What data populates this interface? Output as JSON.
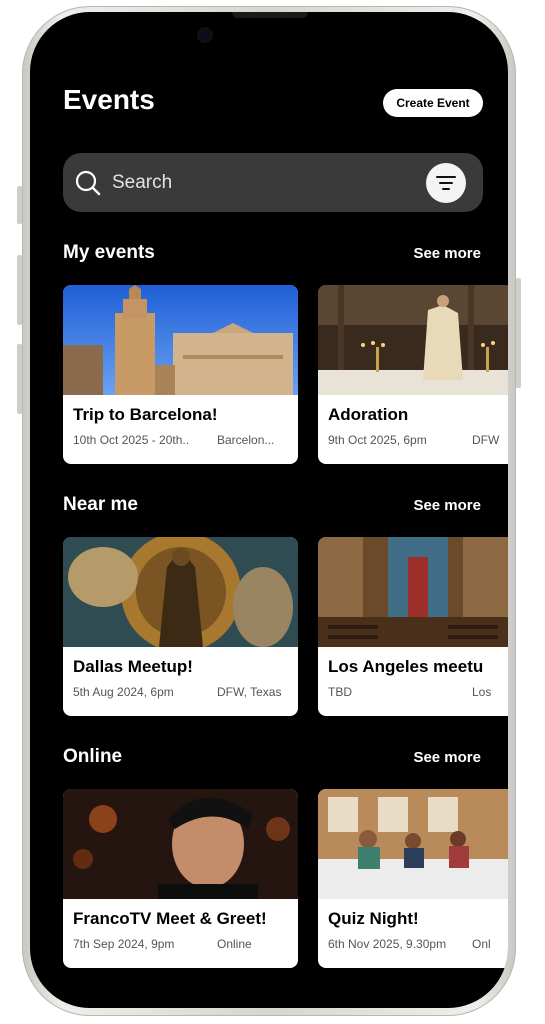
{
  "header": {
    "title": "Events",
    "create_label": "Create Event"
  },
  "search": {
    "placeholder": "Search"
  },
  "sections": [
    {
      "title": "My events",
      "see_more": "See more",
      "cards": [
        {
          "title": "Trip to Barcelona!",
          "date": "10th Oct 2025 - 20th..",
          "location": "Barcelon...",
          "image": "barcelona-cathedral"
        },
        {
          "title": "Adoration",
          "date": "9th Oct 2025, 6pm",
          "location": "DFW",
          "image": "altar-adoration"
        }
      ]
    },
    {
      "title": "Near me",
      "see_more": "See more",
      "cards": [
        {
          "title": "Dallas Meetup!",
          "date": "5th Aug 2024, 6pm",
          "location": "DFW, Texas",
          "image": "madonna-statue"
        },
        {
          "title": "Los Angeles meetu",
          "date": "TBD",
          "location": "Los",
          "image": "church-interior"
        }
      ]
    },
    {
      "title": "Online",
      "see_more": "See more",
      "cards": [
        {
          "title": "FrancoTV Meet & Greet!",
          "date": "7th Sep 2024, 9pm",
          "location": "Online",
          "image": "portrait"
        },
        {
          "title": "Quiz Night!",
          "date": "6th Nov 2025, 9.30pm",
          "location": "Onl",
          "image": "quiz-room"
        }
      ]
    }
  ],
  "colors": {
    "background": "#000000",
    "card": "#ffffff",
    "search": "#3a3a3a",
    "frame": "#e6e4df"
  }
}
